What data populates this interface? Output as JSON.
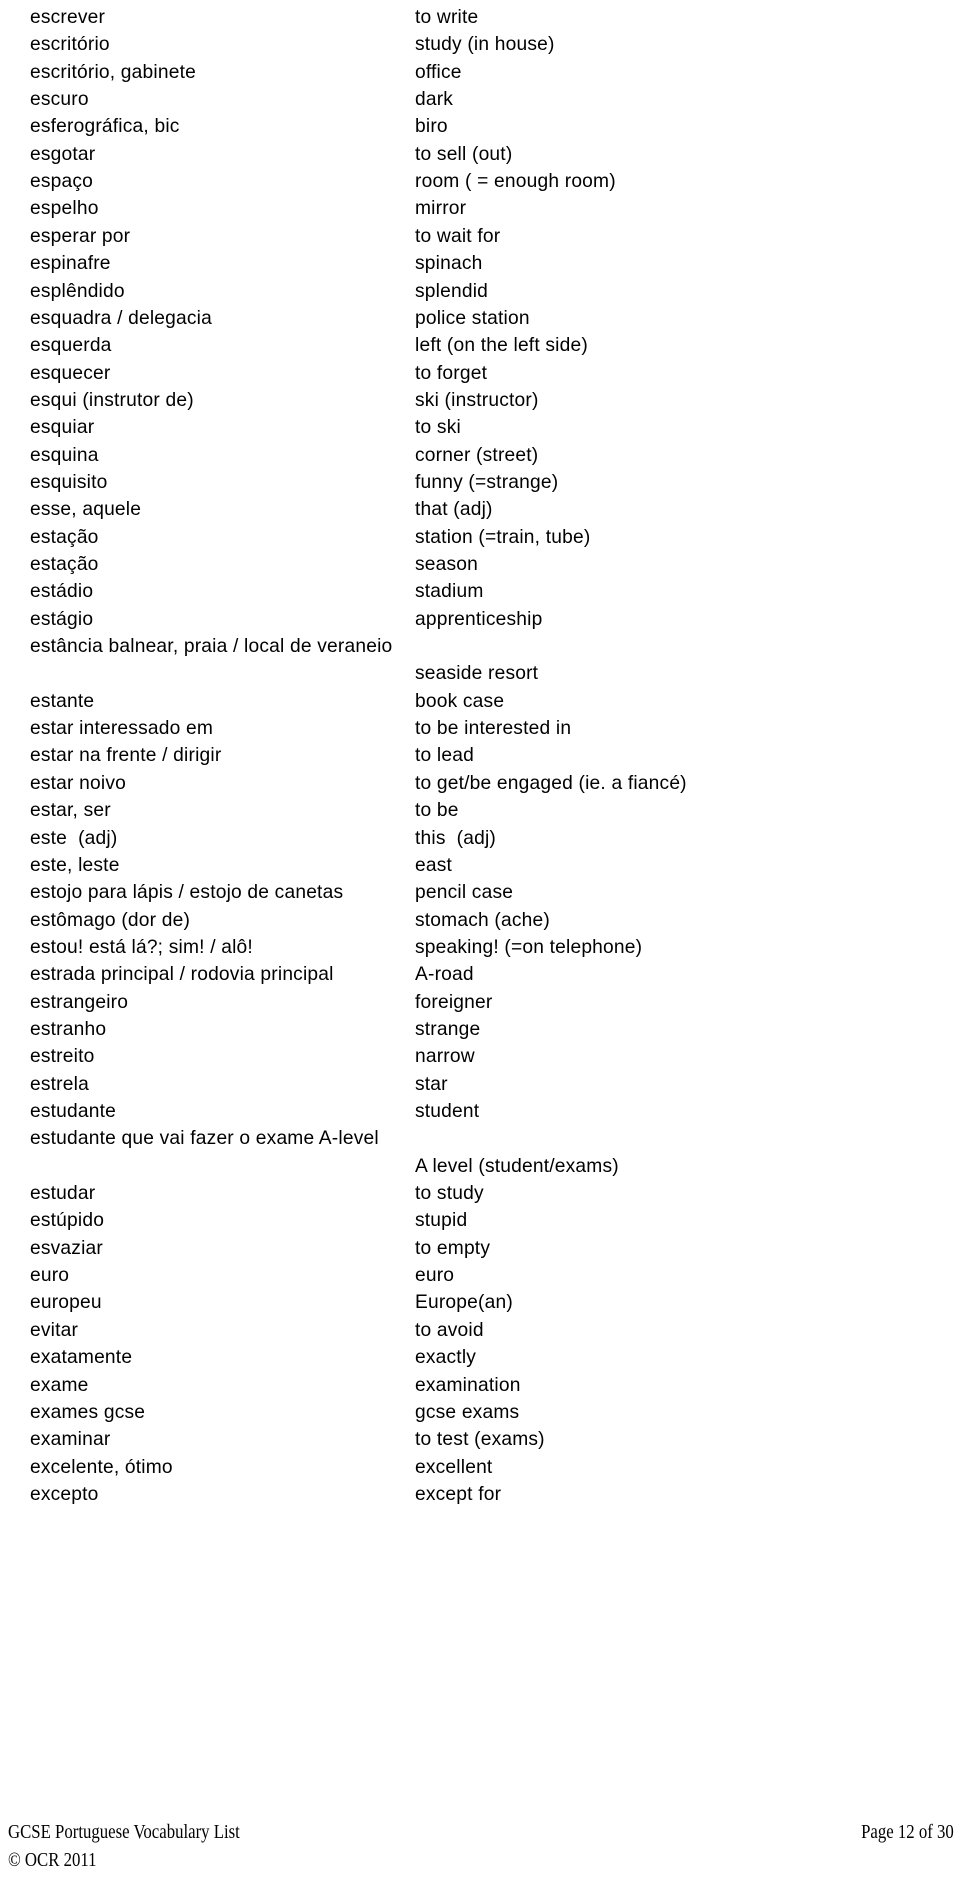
{
  "document": {
    "title": "GCSE Portuguese Vocabulary List",
    "columns": {
      "source_language": "Portuguese",
      "target_language": "English"
    }
  },
  "entries": [
    {
      "term": "escrever",
      "gloss": "to write",
      "wrapped": false
    },
    {
      "term": "escritório",
      "gloss": "study (in house)",
      "wrapped": false
    },
    {
      "term": "escritório, gabinete",
      "gloss": "office",
      "wrapped": false
    },
    {
      "term": "escuro",
      "gloss": "dark",
      "wrapped": false
    },
    {
      "term": "esferográfica, bic",
      "gloss": "biro",
      "wrapped": false
    },
    {
      "term": "esgotar",
      "gloss": "to sell (out)",
      "wrapped": false
    },
    {
      "term": "espaço",
      "gloss": "room ( = enough room)",
      "wrapped": false
    },
    {
      "term": "espelho",
      "gloss": "mirror",
      "wrapped": false
    },
    {
      "term": "esperar por",
      "gloss": "to wait for",
      "wrapped": false
    },
    {
      "term": "espinafre",
      "gloss": "spinach",
      "wrapped": false
    },
    {
      "term": "esplêndido",
      "gloss": "splendid",
      "wrapped": false
    },
    {
      "term": "esquadra / delegacia",
      "gloss": "police station",
      "wrapped": false
    },
    {
      "term": "esquerda",
      "gloss": "left (on the left side)",
      "wrapped": false
    },
    {
      "term": "esquecer",
      "gloss": "to forget",
      "wrapped": false
    },
    {
      "term": "esqui (instrutor de)",
      "gloss": "ski (instructor)",
      "wrapped": false
    },
    {
      "term": "esquiar",
      "gloss": "to ski",
      "wrapped": false
    },
    {
      "term": "esquina",
      "gloss": "corner (street)",
      "wrapped": false
    },
    {
      "term": "esquisito",
      "gloss": "funny (=strange)",
      "wrapped": false
    },
    {
      "term": "esse, aquele",
      "gloss": "that (adj)",
      "wrapped": false
    },
    {
      "term": "estação",
      "gloss": "station (=train, tube)",
      "wrapped": false
    },
    {
      "term": "estação",
      "gloss": "season",
      "wrapped": false
    },
    {
      "term": "estádio",
      "gloss": "stadium",
      "wrapped": false
    },
    {
      "term": "estágio",
      "gloss": "apprenticeship",
      "wrapped": false
    },
    {
      "term": "estância balnear, praia / local de veraneio",
      "gloss": "seaside resort",
      "wrapped": true
    },
    {
      "term": "estante",
      "gloss": "book case",
      "wrapped": false
    },
    {
      "term": "estar interessado em",
      "gloss": "to be interested in",
      "wrapped": false
    },
    {
      "term": "estar na frente / dirigir",
      "gloss": "to lead",
      "wrapped": false
    },
    {
      "term": "estar noivo",
      "gloss": "to get/be engaged (ie. a fiancé)",
      "wrapped": false
    },
    {
      "term": "estar, ser",
      "gloss": "to be",
      "wrapped": false
    },
    {
      "term": "este  (adj)",
      "gloss": "this  (adj)",
      "wrapped": false
    },
    {
      "term": "este, leste",
      "gloss": "east",
      "wrapped": false
    },
    {
      "term": "estojo para lápis / estojo de canetas",
      "gloss": "pencil case",
      "wrapped": false
    },
    {
      "term": "estômago (dor de)",
      "gloss": "stomach (ache)",
      "wrapped": false
    },
    {
      "term": "estou! está lá?; sim! / alô!",
      "gloss": "speaking! (=on telephone)",
      "wrapped": false
    },
    {
      "term": "estrada principal / rodovia principal",
      "gloss": "A-road",
      "wrapped": false
    },
    {
      "term": "estrangeiro",
      "gloss": "foreigner",
      "wrapped": false
    },
    {
      "term": "estranho",
      "gloss": "strange",
      "wrapped": false
    },
    {
      "term": "estreito",
      "gloss": "narrow",
      "wrapped": false
    },
    {
      "term": "estrela",
      "gloss": "star",
      "wrapped": false
    },
    {
      "term": "estudante",
      "gloss": "student",
      "wrapped": false
    },
    {
      "term": "estudante que vai fazer o exame A-level",
      "gloss": "A level (student/exams)",
      "wrapped": true
    },
    {
      "term": "estudar",
      "gloss": "to study",
      "wrapped": false
    },
    {
      "term": "estúpido",
      "gloss": "stupid",
      "wrapped": false
    },
    {
      "term": "esvaziar",
      "gloss": "to empty",
      "wrapped": false
    },
    {
      "term": "euro",
      "gloss": "euro",
      "wrapped": false
    },
    {
      "term": "europeu",
      "gloss": "Europe(an)",
      "wrapped": false
    },
    {
      "term": "evitar",
      "gloss": "to avoid",
      "wrapped": false
    },
    {
      "term": "exatamente",
      "gloss": "exactly",
      "wrapped": false
    },
    {
      "term": "exame",
      "gloss": "examination",
      "wrapped": false
    },
    {
      "term": "exames gcse",
      "gloss": "gcse exams",
      "wrapped": false
    },
    {
      "term": "examinar",
      "gloss": "to test (exams)",
      "wrapped": false
    },
    {
      "term": "excelente, ótimo",
      "gloss": "excellent",
      "wrapped": false
    },
    {
      "term": "excepto",
      "gloss": "except for",
      "wrapped": false
    }
  ],
  "footer": {
    "title": "GCSE Portuguese Vocabulary List",
    "copyright": "© OCR 2011",
    "page": "Page 12 of 30"
  }
}
